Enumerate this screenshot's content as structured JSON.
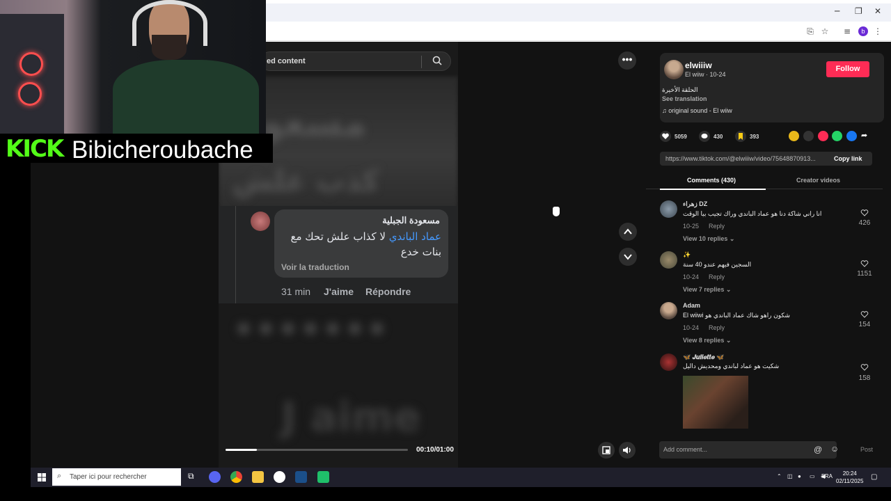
{
  "browser": {
    "minimize": "─",
    "maximize": "❐",
    "close": "✕",
    "profile_initial": "b"
  },
  "search": {
    "text": "ed content"
  },
  "video": {
    "blur_text_1": "مسعو",
    "blur_text_2": "كذب علش",
    "blur_text_3": "J aime",
    "progress": 0.17,
    "timecode": "00:10/01:00"
  },
  "fb_comment": {
    "name": "مسعودة الجبلية",
    "mention": "عماد الباندي",
    "text": " لا كذاب علش تحك مع بنات خدع",
    "translate": "Voir la traduction",
    "time": "31 min",
    "like": "J'aime",
    "reply": "Répondre"
  },
  "author": {
    "username": "elwiiiw",
    "subline": "El wiiw · 10-24",
    "follow": "Follow",
    "description": "الحلقة الأخيرة",
    "see_translation": "See translation",
    "sound": "♫  original sound - El wiiw"
  },
  "stats": {
    "likes": "5059",
    "comments": "430",
    "saves": "393"
  },
  "link": {
    "url": "https://www.tiktok.com/@elwiiiw/video/75648870913...",
    "copy": "Copy link"
  },
  "tabs": {
    "comments": "Comments (430)",
    "creator": "Creator videos"
  },
  "comments": [
    {
      "name": "زهراء DZ",
      "text": "انا راني شاكة دنا هو عماد الباندي وراك تجيب بيا الوقت",
      "date": "10-25",
      "reply": "Reply",
      "view": "View 10 replies ⌄",
      "likes": "426"
    },
    {
      "name": "✨",
      "text": "السجين فيهم عندو 40 سنة",
      "date": "10-24",
      "reply": "Reply",
      "view": "View 7 replies ⌄",
      "likes": "1151"
    },
    {
      "name": "Adam",
      "text": "El wiiwi شكون راهو شاك عماد الباندي هو",
      "date": "10-24",
      "reply": "Reply",
      "view": "View 8 replies ⌄",
      "likes": "154"
    },
    {
      "name": "🦋 𝑱𝒖𝒍𝒊𝒆𝒕𝒕𝒆 🦋",
      "text": "شكيت هو عماد لباندي ومحديش داليل",
      "likes": "158"
    }
  ],
  "add_comment": {
    "placeholder": "Add comment...",
    "post": "Post"
  },
  "stream": {
    "platform": "KICK",
    "username": "Bibicheroubache"
  },
  "taskbar": {
    "search_placeholder": "Taper ici pour rechercher",
    "lang": "FRA",
    "time": "20:24",
    "date": "02/11/2025"
  }
}
